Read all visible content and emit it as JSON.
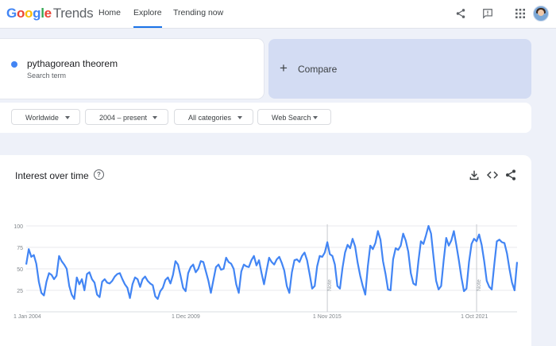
{
  "header": {
    "logo_google": "Google",
    "logo_trends": "Trends",
    "nav": [
      {
        "label": "Home"
      },
      {
        "label": "Explore"
      },
      {
        "label": "Trending now"
      }
    ],
    "icons": [
      "share-icon",
      "feedback-icon",
      "apps-grid-icon",
      "account-avatar"
    ]
  },
  "search": {
    "term": "pythagorean theorem",
    "term_sublabel": "Search term",
    "term_color": "#4285f4",
    "compare_label": "Compare"
  },
  "filters": [
    {
      "label": "Worldwide"
    },
    {
      "label": "2004 – present"
    },
    {
      "label": "All categories"
    },
    {
      "label": "Web Search"
    }
  ],
  "interest": {
    "title": "Interest over time",
    "actions": [
      "download-icon",
      "embed-icon",
      "share-icon"
    ]
  },
  "chart_data": {
    "type": "line",
    "title": "Interest over time",
    "line_color": "#4285f4",
    "ylim": [
      0,
      100
    ],
    "y_ticks": [
      "100",
      "75",
      "50",
      "25"
    ],
    "x_tick_labels": [
      "1 Jan 2004",
      "1 Dec 2009",
      "1 Nov 2015",
      "1 Oct 2021"
    ],
    "annotations": [
      "Note",
      "Note"
    ],
    "grid": true,
    "series": [
      {
        "values": [
          55,
          73,
          64,
          66,
          56,
          35,
          22,
          19,
          35,
          45,
          43,
          38,
          42,
          65,
          59,
          55,
          50,
          30,
          20,
          15,
          40,
          32,
          38,
          25,
          44,
          46,
          38,
          34,
          20,
          17,
          35,
          38,
          34,
          33,
          36,
          41,
          44,
          45,
          38,
          32,
          28,
          16,
          32,
          40,
          38,
          29,
          38,
          41,
          36,
          33,
          31,
          18,
          15,
          24,
          28,
          37,
          40,
          33,
          43,
          59,
          55,
          42,
          28,
          24,
          45,
          52,
          55,
          46,
          50,
          59,
          58,
          47,
          36,
          22,
          37,
          52,
          55,
          49,
          50,
          63,
          58,
          56,
          50,
          32,
          22,
          47,
          55,
          53,
          52,
          60,
          65,
          54,
          60,
          45,
          32,
          48,
          63,
          58,
          55,
          61,
          64,
          57,
          48,
          30,
          22,
          46,
          60,
          61,
          58,
          65,
          69,
          60,
          44,
          27,
          30,
          53,
          65,
          64,
          69,
          81,
          67,
          65,
          55,
          30,
          27,
          51,
          69,
          78,
          74,
          85,
          76,
          57,
          42,
          30,
          20,
          53,
          77,
          73,
          80,
          94,
          84,
          59,
          44,
          26,
          25,
          61,
          74,
          72,
          77,
          91,
          83,
          70,
          45,
          33,
          31,
          59,
          82,
          79,
          89,
          100,
          91,
          63,
          36,
          26,
          30,
          60,
          86,
          77,
          83,
          94,
          78,
          60,
          40,
          24,
          27,
          58,
          79,
          85,
          82,
          90,
          78,
          59,
          36,
          29,
          26,
          55,
          82,
          84,
          81,
          80,
          68,
          50,
          34,
          25,
          58
        ]
      }
    ]
  }
}
